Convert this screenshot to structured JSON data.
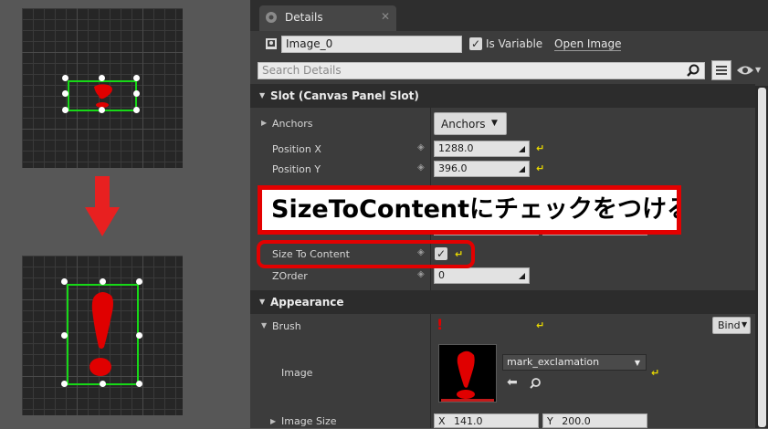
{
  "details_tab": {
    "label": "Details"
  },
  "widget": {
    "name": "Image_0",
    "is_variable_label": "Is Variable",
    "is_variable_checked": true,
    "open_image_label": "Open Image"
  },
  "search": {
    "placeholder": "Search Details"
  },
  "slot_section": {
    "title": "Slot (Canvas Panel Slot)",
    "anchors_label": "Anchors",
    "anchors_button": "Anchors",
    "position_x_label": "Position X",
    "position_x_value": "1288.0",
    "position_y_label": "Position Y",
    "position_y_value": "396.0",
    "size_to_content_label": "Size To Content",
    "size_to_content_checked": true,
    "zorder_label": "ZOrder",
    "zorder_value": "0"
  },
  "appearance_section": {
    "title": "Appearance",
    "brush_label": "Brush",
    "bind_button": "Bind",
    "image_label": "Image",
    "image_asset": "mark_exclamation",
    "image_size_label": "Image Size",
    "image_size_x_label": "X",
    "image_size_x_value": "141.0",
    "image_size_y_label": "Y",
    "image_size_y_value": "200.0"
  },
  "annotation": {
    "text": "SizeToContentにチェックをつける"
  },
  "colors": {
    "highlight_red": "#e30000",
    "selection_green": "#17d817",
    "mark_red": "#e00000",
    "reset_yellow": "#e8d800"
  },
  "icons": [
    "down-arrow-icon",
    "magnifier-icon",
    "grid-view-icon",
    "eye-icon",
    "widget-icon",
    "reset-to-default-icon",
    "keyframe-icon",
    "chevron-down-icon",
    "browse-arrow-icon"
  ]
}
